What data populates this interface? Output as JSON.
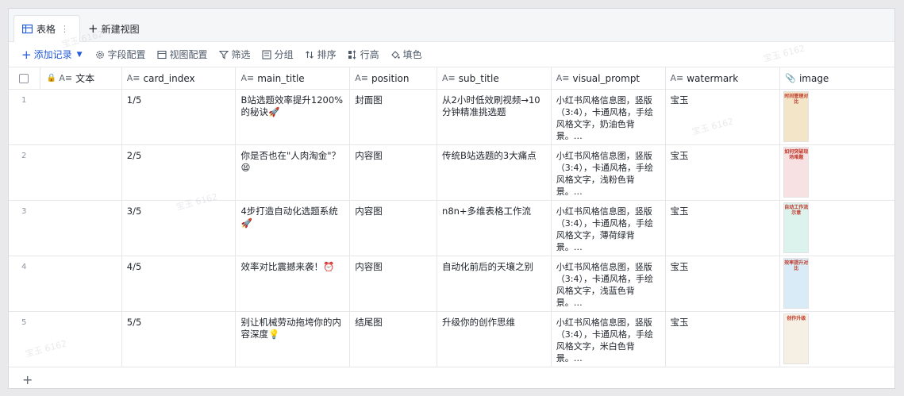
{
  "tabs": {
    "table_label": "表格",
    "more": "⋮",
    "new_view": "新建视图"
  },
  "toolbar": {
    "add_record": "添加记录",
    "field_config": "字段配置",
    "view_config": "视图配置",
    "filter": "筛选",
    "group": "分组",
    "sort": "排序",
    "row_height": "行高",
    "fill": "填色"
  },
  "columns": {
    "text": "文本",
    "card_index": "card_index",
    "main_title": "main_title",
    "position": "position",
    "sub_title": "sub_title",
    "visual_prompt": "visual_prompt",
    "watermark": "watermark",
    "image": "image"
  },
  "rows": [
    {
      "num": "1",
      "card_index": "1/5",
      "main_title": "B站选题效率提升1200%的秘诀🚀",
      "position": "封面图",
      "sub_title": "从2小时低效刷视频→10分钟精准挑选题",
      "visual_prompt": "小红书风格信息图，竖版（3:4），卡通风格，手绘风格文字，奶油色背景。…",
      "watermark": "宝玉",
      "thumb_title": "时间管理对比",
      "thumb_color": "#f3e6c8"
    },
    {
      "num": "2",
      "card_index": "2/5",
      "main_title": "你是否也在\"人肉淘金\"？😫",
      "position": "内容图",
      "sub_title": "传统B站选题的3大痛点",
      "visual_prompt": "小红书风格信息图，竖版（3:4），卡通风格，手绘风格文字，浅粉色背景。…",
      "watermark": "宝玉",
      "thumb_title": "如何突破现场难题",
      "thumb_color": "#f8e1e3"
    },
    {
      "num": "3",
      "card_index": "3/5",
      "main_title": "4步打造自动化选题系统🚀",
      "position": "内容图",
      "sub_title": "n8n+多维表格工作流",
      "visual_prompt": "小红书风格信息图，竖版（3:4），卡通风格，手绘风格文字，薄荷绿背景。…",
      "watermark": "宝玉",
      "thumb_title": "自动工作流示意",
      "thumb_color": "#dcf2ec"
    },
    {
      "num": "4",
      "card_index": "4/5",
      "main_title": "效率对比震撼来袭！⏰",
      "position": "内容图",
      "sub_title": "自动化前后的天壤之别",
      "visual_prompt": "小红书风格信息图，竖版（3:4），卡通风格，手绘风格文字，浅蓝色背景。…",
      "watermark": "宝玉",
      "thumb_title": "效率提升对比",
      "thumb_color": "#d9ebf7"
    },
    {
      "num": "5",
      "card_index": "5/5",
      "main_title": "别让机械劳动拖垮你的内容深度💡",
      "position": "结尾图",
      "sub_title": "升级你的创作思维",
      "visual_prompt": "小红书风格信息图，竖版（3:4），卡通风格，手绘风格文字，米白色背景。…",
      "watermark": "宝玉",
      "thumb_title": "创作升级",
      "thumb_color": "#f5f0e3"
    }
  ],
  "add_row": "+",
  "accent_color": "#245bdb"
}
